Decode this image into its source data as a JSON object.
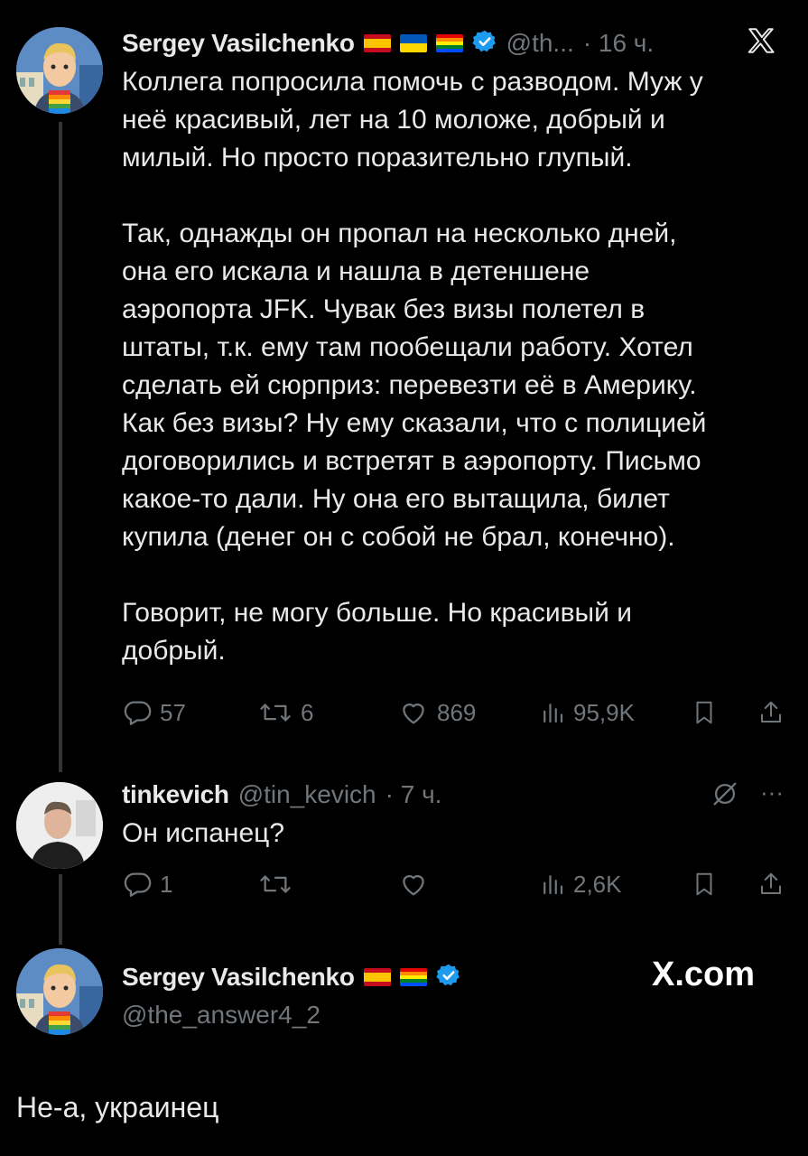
{
  "tweet": {
    "author_name": "Sergey Vasilchenko",
    "handle": "@th...",
    "time": "· 16 ч.",
    "text": "Коллега попросила помочь с разводом. Муж у\nнеё красивый, лет на 10 моложе, добрый и\nмилый. Но просто поразительно глупый.\n\nТак, однажды он пропал на несколько дней,\nона его искала и нашла в детеншене\nаэропорта JFK. Чувак без визы полетел в\nштаты, т.к. ему там пообещали работу. Хотел\nсделать ей сюрприз: перевезти её в Америку.\nКак без визы? Ну ему сказали, что с полицией\nдоговорились и встретят в аэропорту. Письмо\nкакое-то дали. Ну она его вытащила, билет\nкупила (денег он с собой не брал, конечно).\n\nГоворит, не могу больше. Но красивый и\nдобрый.",
    "replies": "57",
    "reposts": "6",
    "likes": "869",
    "views": "95,9K"
  },
  "reply": {
    "author_name": "tinkevich",
    "handle": "@tin_kevich",
    "time": "· 7 ч.",
    "text": "Он испанец?",
    "replies": "1",
    "reposts": "",
    "likes": "",
    "views": "2,6K",
    "more_label": "···"
  },
  "composer": {
    "author_name": "Sergey Vasilchenko",
    "handle": "@the_answer4_2",
    "site": "X.com",
    "text": "Не-а, украинец"
  },
  "icons": {
    "close": "x-logo-icon",
    "verified": "verified-badge-icon"
  },
  "colors": {
    "verified": "#1d9bf0",
    "muted": "#71767b",
    "text": "#e7e9ea"
  }
}
